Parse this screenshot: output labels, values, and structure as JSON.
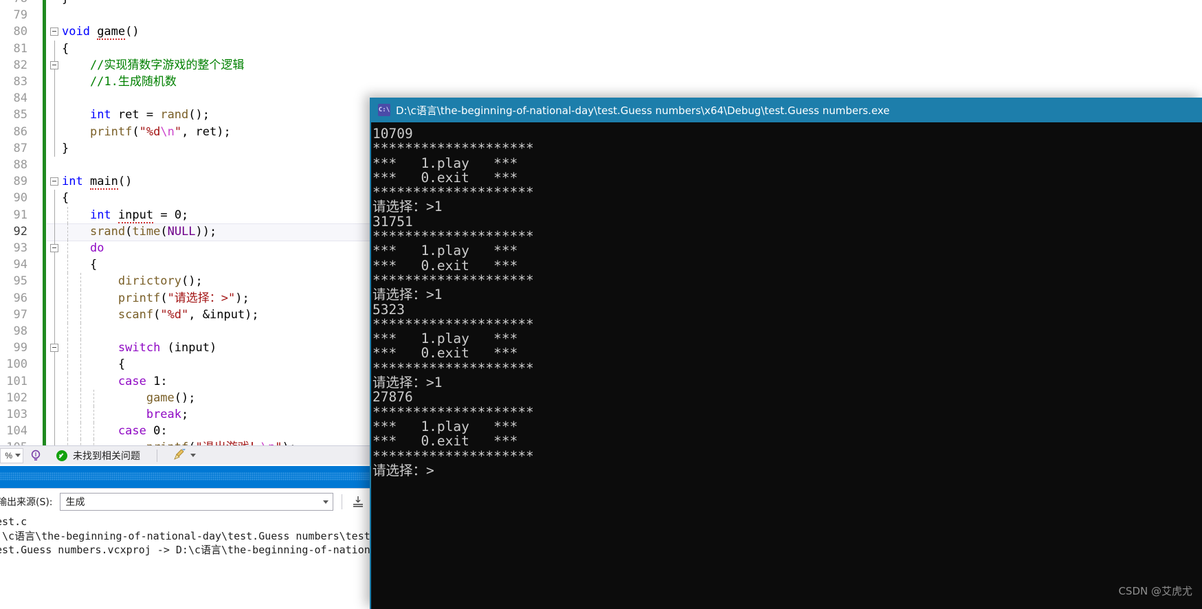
{
  "editor": {
    "lines": [
      {
        "num": "78",
        "fold": false,
        "green": true,
        "partial": true,
        "segs": [
          {
            "t": "}",
            "c": "plain"
          }
        ],
        "indent": 0
      },
      {
        "num": "79",
        "fold": false,
        "green": true,
        "segs": [],
        "indent": 0
      },
      {
        "num": "80",
        "fold": true,
        "green": true,
        "segs": [
          {
            "t": "void ",
            "c": "kw"
          },
          {
            "t": "game",
            "c": "plain sq"
          },
          {
            "t": "()",
            "c": "plain"
          }
        ],
        "indent": 0
      },
      {
        "num": "81",
        "fold": false,
        "green": true,
        "segs": [
          {
            "t": "{",
            "c": "plain"
          }
        ],
        "indent": 1
      },
      {
        "num": "82",
        "fold": true,
        "green": true,
        "segs": [
          {
            "t": "    //实现猜数字游戏的整个逻辑",
            "c": "cmt"
          }
        ],
        "indent": 1
      },
      {
        "num": "83",
        "fold": false,
        "green": true,
        "segs": [
          {
            "t": "    //1.生成随机数",
            "c": "cmt"
          }
        ],
        "indent": 1
      },
      {
        "num": "84",
        "fold": false,
        "green": true,
        "segs": [],
        "indent": 1
      },
      {
        "num": "85",
        "fold": false,
        "green": true,
        "segs": [
          {
            "t": "    ",
            "c": "plain"
          },
          {
            "t": "int",
            "c": "kw"
          },
          {
            "t": " ret = ",
            "c": "plain"
          },
          {
            "t": "rand",
            "c": "fn"
          },
          {
            "t": "();",
            "c": "plain"
          }
        ],
        "indent": 1
      },
      {
        "num": "86",
        "fold": false,
        "green": true,
        "segs": [
          {
            "t": "    ",
            "c": "plain"
          },
          {
            "t": "printf",
            "c": "fn"
          },
          {
            "t": "(",
            "c": "plain"
          },
          {
            "t": "\"%d",
            "c": "str"
          },
          {
            "t": "\\n",
            "c": "esc"
          },
          {
            "t": "\"",
            "c": "str"
          },
          {
            "t": ", ret);",
            "c": "plain"
          }
        ],
        "indent": 1
      },
      {
        "num": "87",
        "fold": false,
        "green": true,
        "segs": [
          {
            "t": "}",
            "c": "plain"
          }
        ],
        "indent": 1
      },
      {
        "num": "88",
        "fold": false,
        "green": true,
        "segs": [],
        "indent": 0
      },
      {
        "num": "89",
        "fold": true,
        "green": true,
        "segs": [
          {
            "t": "int ",
            "c": "kw"
          },
          {
            "t": "main",
            "c": "plain sq"
          },
          {
            "t": "()",
            "c": "plain"
          }
        ],
        "indent": 0
      },
      {
        "num": "90",
        "fold": false,
        "green": true,
        "segs": [
          {
            "t": "{",
            "c": "plain"
          }
        ],
        "indent": 1
      },
      {
        "num": "91",
        "fold": false,
        "green": true,
        "segs": [
          {
            "t": "    ",
            "c": "plain"
          },
          {
            "t": "int",
            "c": "kw"
          },
          {
            "t": " ",
            "c": "plain"
          },
          {
            "t": "input",
            "c": "plain sq"
          },
          {
            "t": " = 0;",
            "c": "plain"
          }
        ],
        "indent": 2
      },
      {
        "num": "92",
        "fold": false,
        "green": true,
        "current": true,
        "segs": [
          {
            "t": "    ",
            "c": "plain"
          },
          {
            "t": "srand",
            "c": "fn"
          },
          {
            "t": "(",
            "c": "plain"
          },
          {
            "t": "time",
            "c": "fn"
          },
          {
            "t": "(",
            "c": "plain"
          },
          {
            "t": "NULL",
            "c": "mac"
          },
          {
            "t": "));",
            "c": "plain"
          }
        ],
        "indent": 2
      },
      {
        "num": "93",
        "fold": true,
        "green": true,
        "segs": [
          {
            "t": "    ",
            "c": "plain"
          },
          {
            "t": "do",
            "c": "kw2"
          }
        ],
        "indent": 2
      },
      {
        "num": "94",
        "fold": false,
        "green": true,
        "segs": [
          {
            "t": "    {",
            "c": "plain"
          }
        ],
        "indent": 2
      },
      {
        "num": "95",
        "fold": false,
        "green": true,
        "segs": [
          {
            "t": "        ",
            "c": "plain"
          },
          {
            "t": "dirictory",
            "c": "fn"
          },
          {
            "t": "();",
            "c": "plain"
          }
        ],
        "indent": 3
      },
      {
        "num": "96",
        "fold": false,
        "green": true,
        "segs": [
          {
            "t": "        ",
            "c": "plain"
          },
          {
            "t": "printf",
            "c": "fn"
          },
          {
            "t": "(",
            "c": "plain"
          },
          {
            "t": "\"请选择：>\"",
            "c": "str"
          },
          {
            "t": ");",
            "c": "plain"
          }
        ],
        "indent": 3
      },
      {
        "num": "97",
        "fold": false,
        "green": true,
        "segs": [
          {
            "t": "        ",
            "c": "plain"
          },
          {
            "t": "scanf",
            "c": "fn"
          },
          {
            "t": "(",
            "c": "plain"
          },
          {
            "t": "\"%d\"",
            "c": "str"
          },
          {
            "t": ", &input);",
            "c": "plain"
          }
        ],
        "indent": 3
      },
      {
        "num": "98",
        "fold": false,
        "green": true,
        "segs": [],
        "indent": 3
      },
      {
        "num": "99",
        "fold": true,
        "green": true,
        "segs": [
          {
            "t": "        ",
            "c": "plain"
          },
          {
            "t": "switch",
            "c": "kw2"
          },
          {
            "t": " (input)",
            "c": "plain"
          }
        ],
        "indent": 3
      },
      {
        "num": "100",
        "fold": false,
        "green": true,
        "segs": [
          {
            "t": "        {",
            "c": "plain"
          }
        ],
        "indent": 3
      },
      {
        "num": "101",
        "fold": false,
        "green": true,
        "segs": [
          {
            "t": "        ",
            "c": "plain"
          },
          {
            "t": "case",
            "c": "kw2"
          },
          {
            "t": " 1:",
            "c": "plain"
          }
        ],
        "indent": 3
      },
      {
        "num": "102",
        "fold": false,
        "green": true,
        "segs": [
          {
            "t": "            ",
            "c": "plain"
          },
          {
            "t": "game",
            "c": "fn"
          },
          {
            "t": "();",
            "c": "plain"
          }
        ],
        "indent": 4
      },
      {
        "num": "103",
        "fold": false,
        "green": true,
        "segs": [
          {
            "t": "            ",
            "c": "plain"
          },
          {
            "t": "break",
            "c": "kw2"
          },
          {
            "t": ";",
            "c": "plain"
          }
        ],
        "indent": 4
      },
      {
        "num": "104",
        "fold": false,
        "green": true,
        "segs": [
          {
            "t": "        ",
            "c": "plain"
          },
          {
            "t": "case",
            "c": "kw2"
          },
          {
            "t": " 0:",
            "c": "plain"
          }
        ],
        "indent": 4
      },
      {
        "num": "105",
        "fold": false,
        "green": true,
        "clipped": true,
        "segs": [
          {
            "t": "            ",
            "c": "plain"
          },
          {
            "t": "printf",
            "c": "fn"
          },
          {
            "t": "(",
            "c": "plain"
          },
          {
            "t": "\"退出游戏！",
            "c": "str"
          },
          {
            "t": "\\n",
            "c": "esc"
          },
          {
            "t": "\"",
            "c": "str"
          },
          {
            "t": ");",
            "c": "plain"
          }
        ],
        "indent": 4
      }
    ]
  },
  "status_bar": {
    "zoom_value": "%",
    "lightbulb_icon": "lightbulb-icon",
    "ok_icon": "check-circle-icon",
    "message": "未找到相关问题",
    "broom_icon": "broom-icon",
    "broom_caret_icon": "chevron-down-icon"
  },
  "output_pane": {
    "source_label": "输出来源(S):",
    "source_value": "生成",
    "source_caret_icon": "chevron-down-icon",
    "action_icon": "save-output-icon",
    "log_lines": [
      "est.c",
      ":\\c语言\\the-beginning-of-national-day\\test.Guess numbers\\test.Guess",
      "est.Guess numbers.vcxproj -> D:\\c语言\\the-beginning-of-national-day"
    ]
  },
  "console_window": {
    "icon": "console-app-icon",
    "icon_text": "C:\\",
    "title": "D:\\c语言\\the-beginning-of-national-day\\test.Guess numbers\\x64\\Debug\\test.Guess numbers.exe",
    "title_bg": "#1d7eab",
    "body_bg": "#0c0c0c",
    "text_color": "#cccccc",
    "lines": [
      "10709",
      "********************",
      "***   1.play   ***",
      "***   0.exit   ***",
      "********************",
      "请选择：>1",
      "31751",
      "********************",
      "***   1.play   ***",
      "***   0.exit   ***",
      "********************",
      "请选择：>1",
      "5323",
      "********************",
      "***   1.play   ***",
      "***   0.exit   ***",
      "********************",
      "请选择：>1",
      "27876",
      "********************",
      "***   1.play   ***",
      "***   0.exit   ***",
      "********************",
      "请选择：>"
    ]
  },
  "watermark": {
    "text": "CSDN @艾虎尤"
  }
}
